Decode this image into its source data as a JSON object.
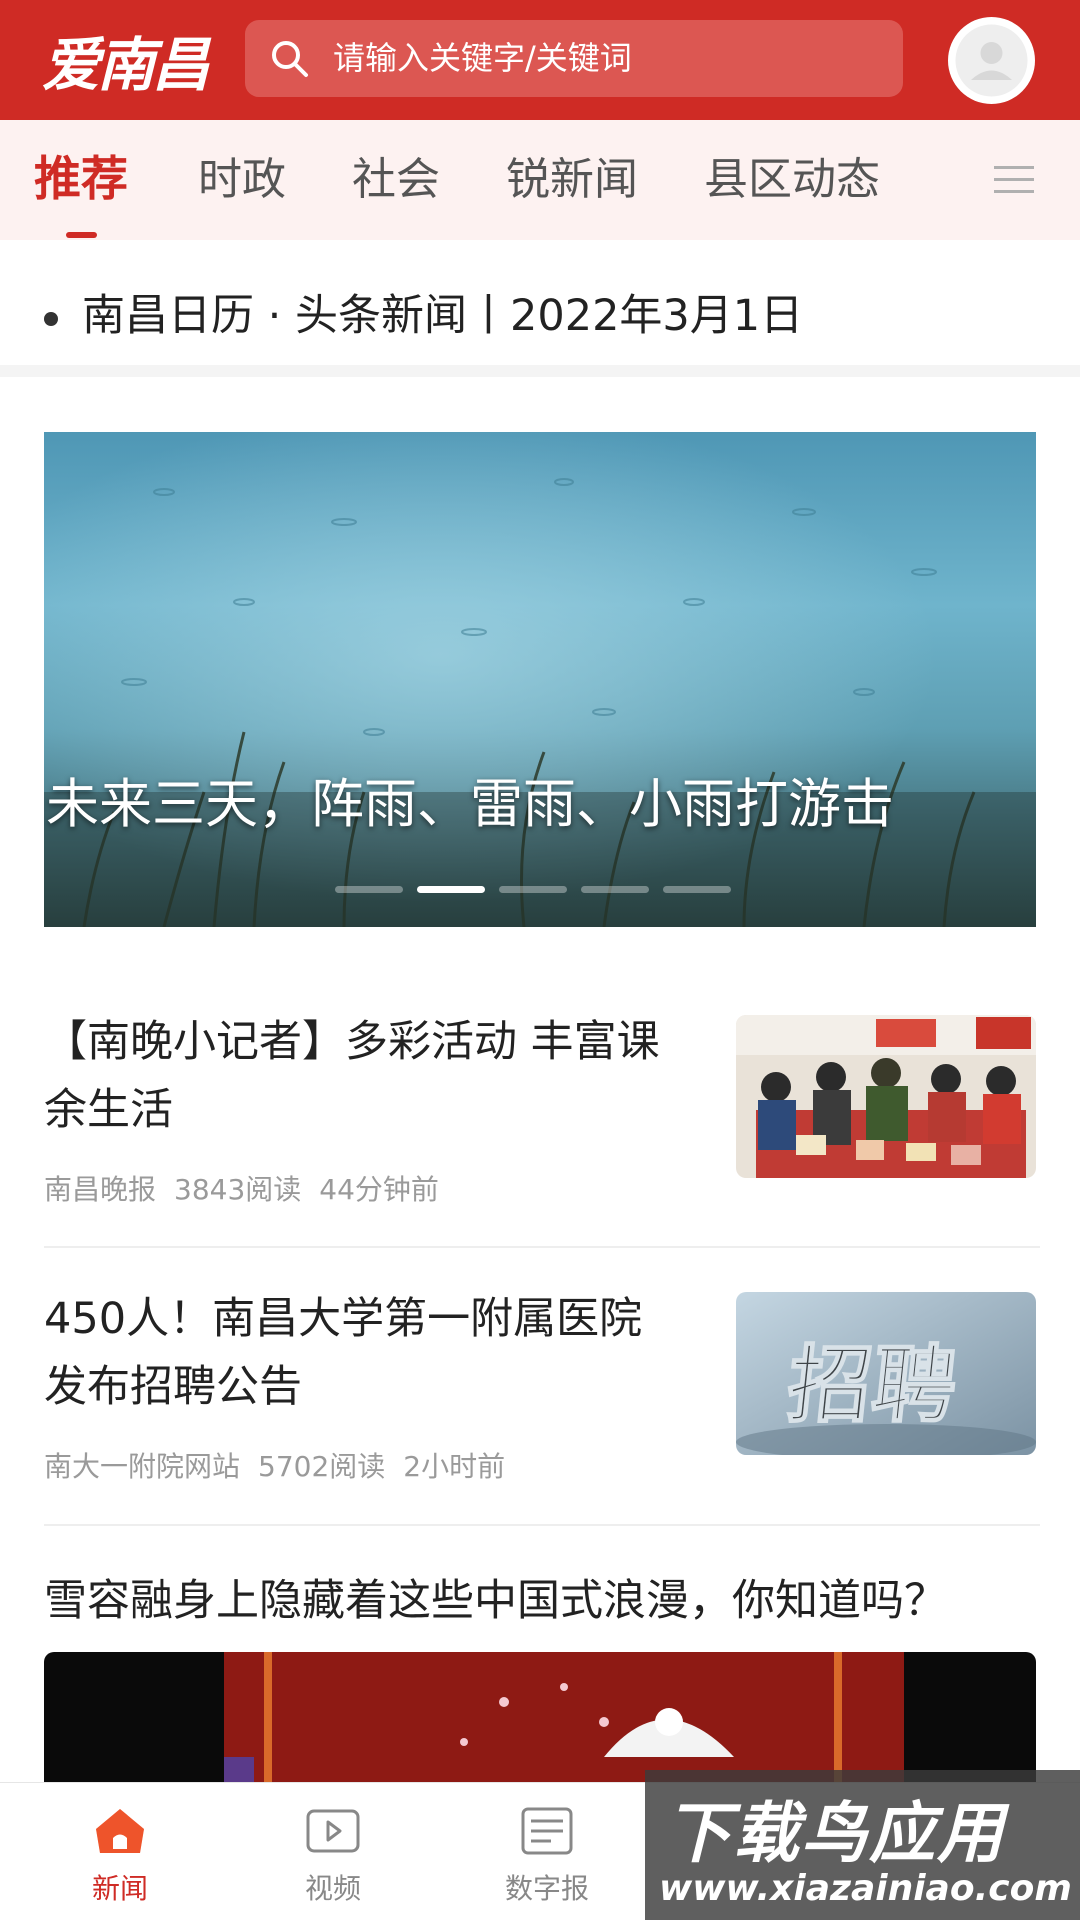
{
  "header": {
    "logo_text": "爱南昌",
    "search_placeholder": "请输入关键字/关键词"
  },
  "tabs": [
    {
      "label": "推荐",
      "active": true
    },
    {
      "label": "时政"
    },
    {
      "label": "社会"
    },
    {
      "label": "锐新闻"
    },
    {
      "label": "县区动态"
    }
  ],
  "calendar": {
    "text": "南昌日历 · 头条新闻丨2022年3月1日"
  },
  "banner": {
    "title": "未来三天，阵雨、雷雨、小雨打游击",
    "slide_count": 5,
    "active_slide": 2
  },
  "news": [
    {
      "title": "【南晚小记者】多彩活动 丰富课余生活",
      "source": "南昌晚报",
      "reads": "3843阅读",
      "time": "44分钟前"
    },
    {
      "title": "450人！南昌大学第一附属医院发布招聘公告",
      "source": "南大一附院网站",
      "reads": "5702阅读",
      "time": "2小时前",
      "thumb_text": "招聘"
    }
  ],
  "video_article": {
    "title": "雪容融身上隐藏着这些中国式浪漫，你知道吗？"
  },
  "bottom_nav": [
    {
      "label": "新闻",
      "icon": "home-icon",
      "active": true
    },
    {
      "label": "视频",
      "icon": "video-icon"
    },
    {
      "label": "数字报",
      "icon": "newspaper-icon"
    }
  ],
  "watermark": {
    "line1": "下载鸟应用",
    "line2": "www.xiazainiao.com"
  },
  "colors": {
    "brand_red": "#cf2b25",
    "tab_bg": "#fdf2f1",
    "meta_gray": "#9a9a9a"
  }
}
